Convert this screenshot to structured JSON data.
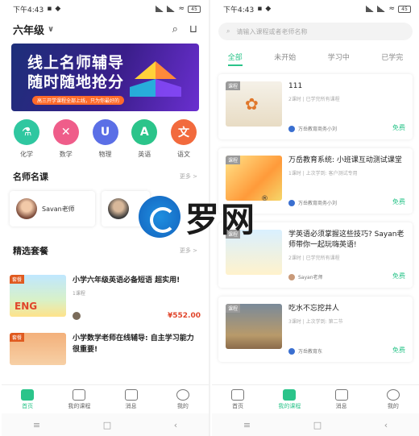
{
  "status_left": {
    "time": "下午4:43",
    "battery": "45"
  },
  "status_right": {
    "time": "下午4:43",
    "battery": "45"
  },
  "home": {
    "grade": "六年级",
    "banner": {
      "line1": "线上名师辅导",
      "line2": "随时随地抢分",
      "tagline": "高三开学课程全部上线，只为你最好的",
      "colors": [
        "#1d2f7a",
        "#6a2fd0"
      ]
    },
    "categories": [
      {
        "label": "化学",
        "icon": "flask-icon",
        "color": "#2fc7a0"
      },
      {
        "label": "数学",
        "icon": "math-icon",
        "color": "#ef5d8a"
      },
      {
        "label": "物理",
        "icon": "magnet-icon",
        "color": "#5b6fe6"
      },
      {
        "label": "英语",
        "icon": "english-icon",
        "color": "#2bc48a"
      },
      {
        "label": "语文",
        "icon": "chinese-icon",
        "color": "#f26a3d"
      }
    ],
    "famous_title": "名师名课",
    "famous_more": "更多 >",
    "teachers": [
      {
        "name": "Savan老师"
      },
      {
        "name": ""
      }
    ],
    "packages_title": "精选套餐",
    "packages_more": "更多 >",
    "packages": [
      {
        "tag": "套餐",
        "title": "小学六年级英语必备短语 超实用!",
        "meta": "1课程",
        "price": "¥552.00"
      },
      {
        "tag": "套餐",
        "title": "小学数学老师在线辅导: 自主学习能力很重要!",
        "meta": "",
        "price": ""
      }
    ]
  },
  "courses": {
    "search_placeholder": "请输入课程或者老师名称",
    "filters": [
      "全部",
      "未开始",
      "学习中",
      "已学完"
    ],
    "active_filter": 0,
    "items": [
      {
        "tag": "课程",
        "title": "111",
        "meta": "2课时 | 已学完所有课程",
        "org": "万岳教育商务小刘",
        "price": "免费"
      },
      {
        "tag": "课程",
        "title": "万岳教育系统: 小班课互动测试课堂",
        "meta": "1课时 | 上次学到: 客户测试专用",
        "org": "万岳教育商务小刘",
        "price": "免费"
      },
      {
        "tag": "课程",
        "title": "学英语必须掌握这些技巧? Sayan老师带你一起玩嗨英语!",
        "meta": "2课时 | 已学完所有课程",
        "org": "Sayan老师",
        "price": "免费"
      },
      {
        "tag": "课程",
        "title": "吃水不忘挖井人",
        "meta": "3课时 | 上次学到: 第二节",
        "org": "万岳教育东",
        "price": "免费"
      }
    ]
  },
  "tabbar": {
    "items": [
      "首页",
      "我的课程",
      "消息",
      "我的"
    ],
    "left_active": 0,
    "right_active": 1,
    "accent": "#2bc48a"
  },
  "watermark": {
    "text": "罗网",
    "mark": "®"
  }
}
